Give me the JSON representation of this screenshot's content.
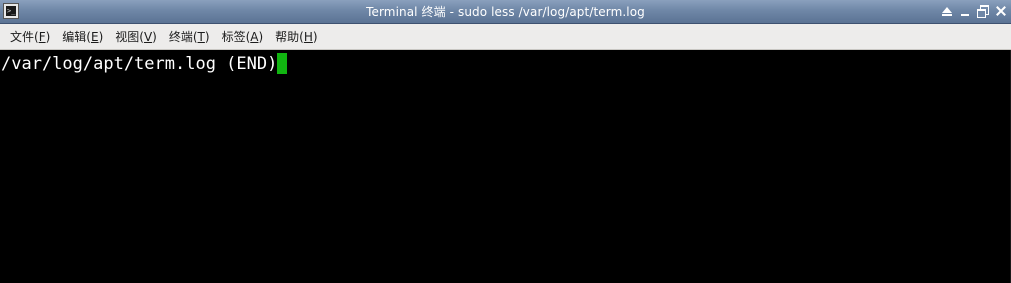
{
  "window": {
    "title": "Terminal 终端 - sudo less /var/log/apt/term.log",
    "app_icon": "terminal-icon",
    "app_icon_glyph": ">_",
    "controls": [
      "shade-icon",
      "minimize-icon",
      "maximize-icon",
      "close-icon"
    ]
  },
  "menubar": {
    "items": [
      {
        "label": "文件(",
        "mnemonic": "F",
        "close": ")"
      },
      {
        "label": "编辑(",
        "mnemonic": "E",
        "close": ")"
      },
      {
        "label": "视图(",
        "mnemonic": "V",
        "close": ")"
      },
      {
        "label": "终端(",
        "mnemonic": "T",
        "close": ")"
      },
      {
        "label": "标签(",
        "mnemonic": "A",
        "close": ")"
      },
      {
        "label": "帮助(",
        "mnemonic": "H",
        "close": ")"
      }
    ]
  },
  "terminal": {
    "status_line": "/var/log/apt/term.log (END)",
    "cursor_color": "#11b511",
    "background": "#000000",
    "foreground": "#ffffff"
  }
}
